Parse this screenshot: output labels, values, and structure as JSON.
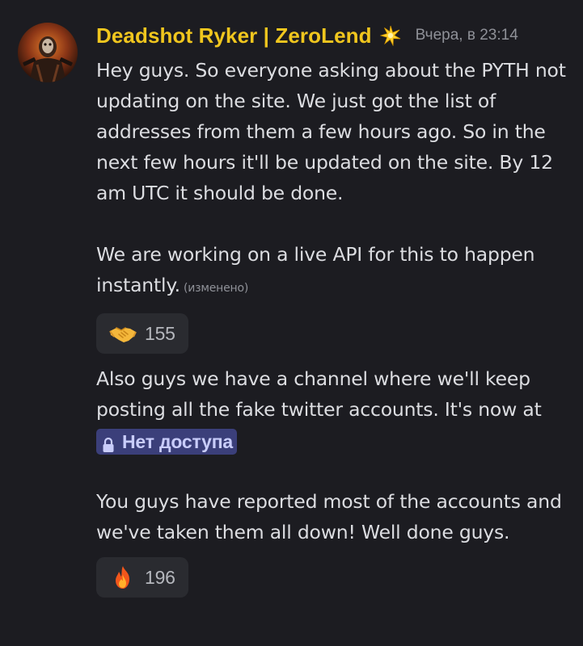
{
  "message": {
    "author": "Deadshot Ryker | ZeroLend",
    "role_icon": "sparkle-star-icon",
    "timestamp": "Вчера, в 23:14",
    "edited_label": "(изменено)",
    "paragraphs": {
      "p1": "Hey guys. So everyone asking about the PYTH not updating on the site. We just got the list of addresses from them a few hours ago. So in the next few hours it'll be updated on the site. By 12 am UTC it should be done.",
      "p2": "We are working on a live API for this to happen instantly.",
      "p3_before": "Also guys we have a channel where we'll keep posting all the fake twitter accounts. It's now at",
      "p4": "You guys have reported most of the accounts and we've taken them all down! Well done guys."
    },
    "channel_mention": {
      "icon": "lock-icon",
      "label": "Нет доступа"
    },
    "reactions": [
      {
        "emoji": "handshake-emoji",
        "count": "155"
      },
      {
        "emoji": "fire-emoji",
        "count": "196"
      }
    ]
  },
  "colors": {
    "background": "#1c1c21",
    "username": "#f0c61e",
    "text": "#dcdde1",
    "muted": "#8f9198",
    "reaction_bg": "#2a2b30",
    "mention_bg": "#3b3f7a",
    "mention_text": "#c9cdfb"
  }
}
